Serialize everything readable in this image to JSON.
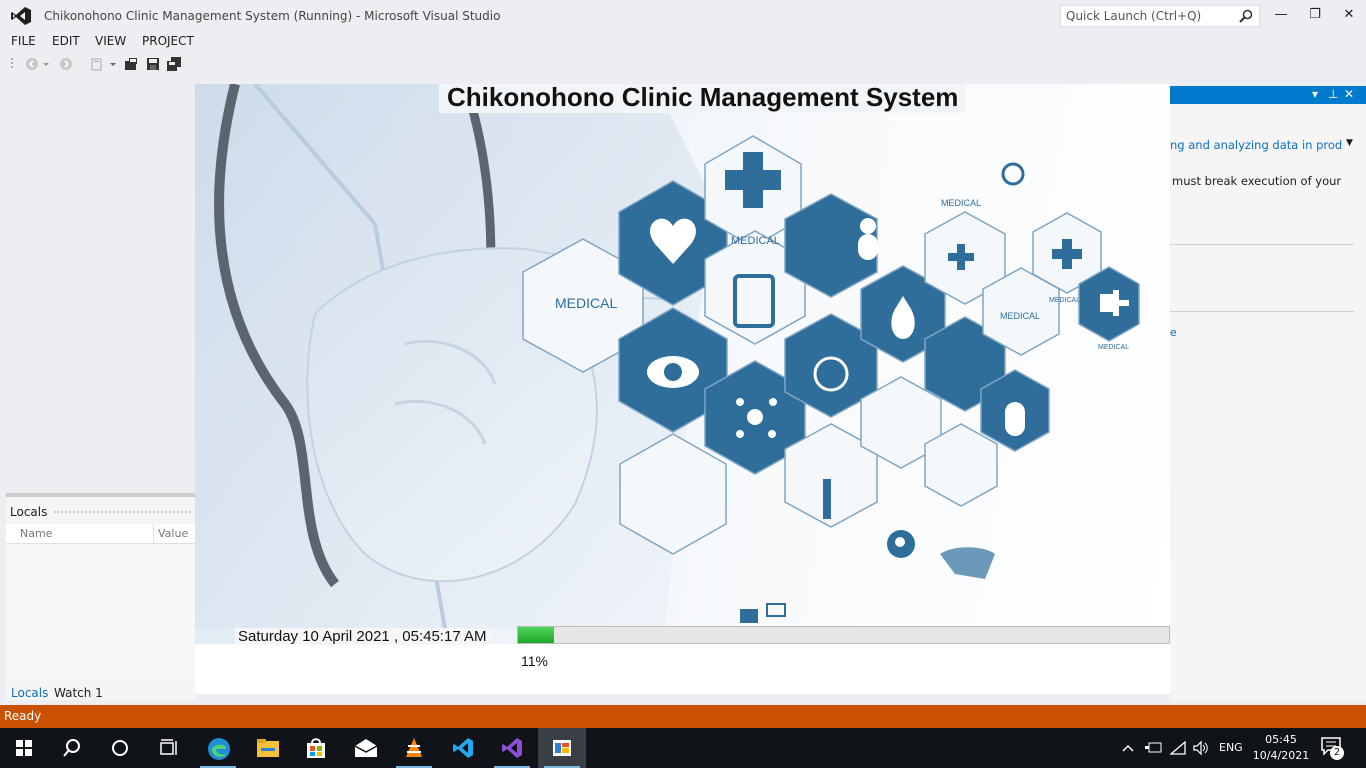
{
  "window": {
    "title": "Chikonohono Clinic Management System (Running) - Microsoft Visual Studio",
    "quick_launch_placeholder": "Quick Launch (Ctrl+Q)",
    "minimize": "—",
    "restore": "❐",
    "close": "✕"
  },
  "menu": {
    "items": [
      "FILE",
      "EDIT",
      "VIEW",
      "PROJECT"
    ]
  },
  "locals_panel": {
    "title": "Locals",
    "columns": {
      "name": "Name",
      "value": "Value"
    },
    "tabs": [
      "Locals",
      "Watch 1"
    ]
  },
  "right_panel": {
    "link_text": "ng and analyzing data in product",
    "body_text": "must break execution of your",
    "fragment": "e"
  },
  "splash": {
    "title": "Chikonohono Clinic Management System",
    "datetime": "Saturday 10 April 2021 , 05:45:17 AM",
    "progress_percent": 11,
    "progress_label": "11%",
    "art_labels": {
      "medical_1": "MEDICAL",
      "medical_2": "MEDICAL",
      "medical_3": "MEDICAL",
      "medical_4": "MEDICAL",
      "medical_5": "MEDICAL",
      "medical_6": "MEDICAL"
    }
  },
  "status": {
    "text": "Ready"
  },
  "taskbar": {
    "language": "ENG",
    "time": "05:45",
    "date": "10/4/2021",
    "notification_count": "2",
    "apps": [
      "start-icon",
      "search-icon",
      "cortana-icon",
      "task-view-icon",
      "edge-icon",
      "file-explorer-icon",
      "store-icon",
      "mail-icon",
      "vlc-icon",
      "vscode-icon",
      "visual-studio-icon",
      "running-app-icon"
    ]
  },
  "colors": {
    "status_bar": "#ca5100",
    "vs_accent": "#007acc",
    "medical_blue": "#2f6d9b",
    "progress_green": "#22b02e"
  }
}
